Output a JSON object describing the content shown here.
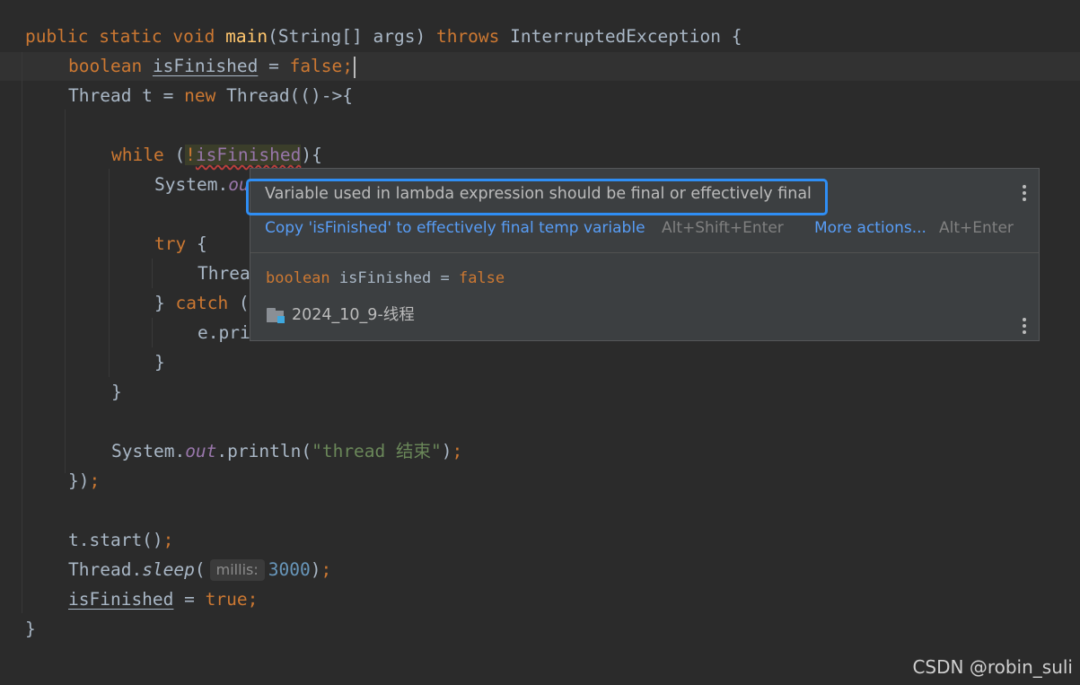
{
  "code": {
    "line1": {
      "kw_public": "public",
      "kw_static": "static",
      "kw_void": "void",
      "method": "main",
      "params": "(String[] args)",
      "kw_throws": "throws",
      "exception": "InterruptedException {"
    },
    "line2": {
      "kw_boolean": "boolean",
      "var": "isFinished",
      "eq": " = ",
      "kw_false": "false",
      "semi": ";"
    },
    "line3": {
      "decl": "Thread t = ",
      "kw_new": "new",
      "ctor": " Thread(()->{"
    },
    "line5": {
      "kw_while": "while",
      "open": " (",
      "not": "!",
      "var": "isFinished",
      "close": "){"
    },
    "line6": {
      "text": "System.",
      "field_fragment": "ou"
    },
    "line8": {
      "kw_try": "try",
      "brace": " {"
    },
    "line9": {
      "text": "Threa"
    },
    "line10": {
      "brace": "} ",
      "kw_catch": "catch",
      "rest": " ("
    },
    "line11": {
      "text": "e.pri"
    },
    "line12": {
      "text": "}"
    },
    "line13": {
      "text": "}"
    },
    "line15": {
      "obj": "System.",
      "field": "out",
      "call": ".println(",
      "str": "\"thread 结束\"",
      "close": ")",
      "semi": ";"
    },
    "line16": {
      "text": "})",
      "semi": ";"
    },
    "line18": {
      "text": "t.start()",
      "semi": ";"
    },
    "line19": {
      "obj": "Thread.",
      "method": "sleep",
      "open": "(",
      "param_hint": "millis:",
      "num": "3000",
      "close": ")",
      "semi": ";"
    },
    "line20": {
      "var": "isFinished",
      "eq": " = ",
      "kw_true": "true",
      "semi": ";"
    },
    "line21": {
      "text": "}"
    }
  },
  "popup": {
    "message": "Variable used in lambda expression should be final or effectively final",
    "fix_action": "Copy 'isFinished' to effectively final temp variable",
    "fix_shortcut": "Alt+Shift+Enter",
    "more_actions": "More actions...",
    "more_shortcut": "Alt+Enter",
    "decl_kw": "boolean",
    "decl_name": " isFinished = ",
    "decl_value": "false",
    "module": "2024_10_9-线程",
    "icons": [
      "more-options-icon",
      "module-folder-icon"
    ]
  },
  "watermark": "CSDN @robin_suli",
  "colors": {
    "background": "#2b2b2b",
    "keyword": "#cc7832",
    "method": "#ffc66d",
    "number": "#6897bb",
    "string": "#6a8759",
    "field": "#9876aa",
    "text": "#a9b7c6",
    "link": "#589df6",
    "focus_border": "#2f8ef4"
  }
}
